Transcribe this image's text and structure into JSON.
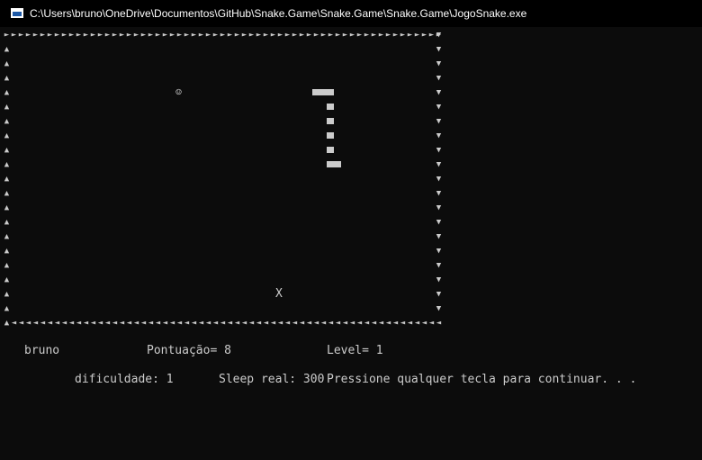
{
  "window": {
    "title": "C:\\Users\\bruno\\OneDrive\\Documentos\\GitHub\\Snake.Game\\Snake.Game\\Snake.Game\\JogoSnake.exe",
    "icon": "console-window-icon"
  },
  "border": {
    "top_char": "►",
    "right_char": "▼",
    "left_char": "▲",
    "bottom_char": "◄"
  },
  "game": {
    "food_char": "☺",
    "obstacle_char": "X"
  },
  "status": {
    "player": "bruno",
    "score_text": "Pontuação= 8",
    "level_text": "Level= 1",
    "difficulty_text": "dificuldade: 1",
    "sleep_text": "Sleep real: 300",
    "prompt_text": "Pressione qualquer tecla para continuar. . ."
  }
}
